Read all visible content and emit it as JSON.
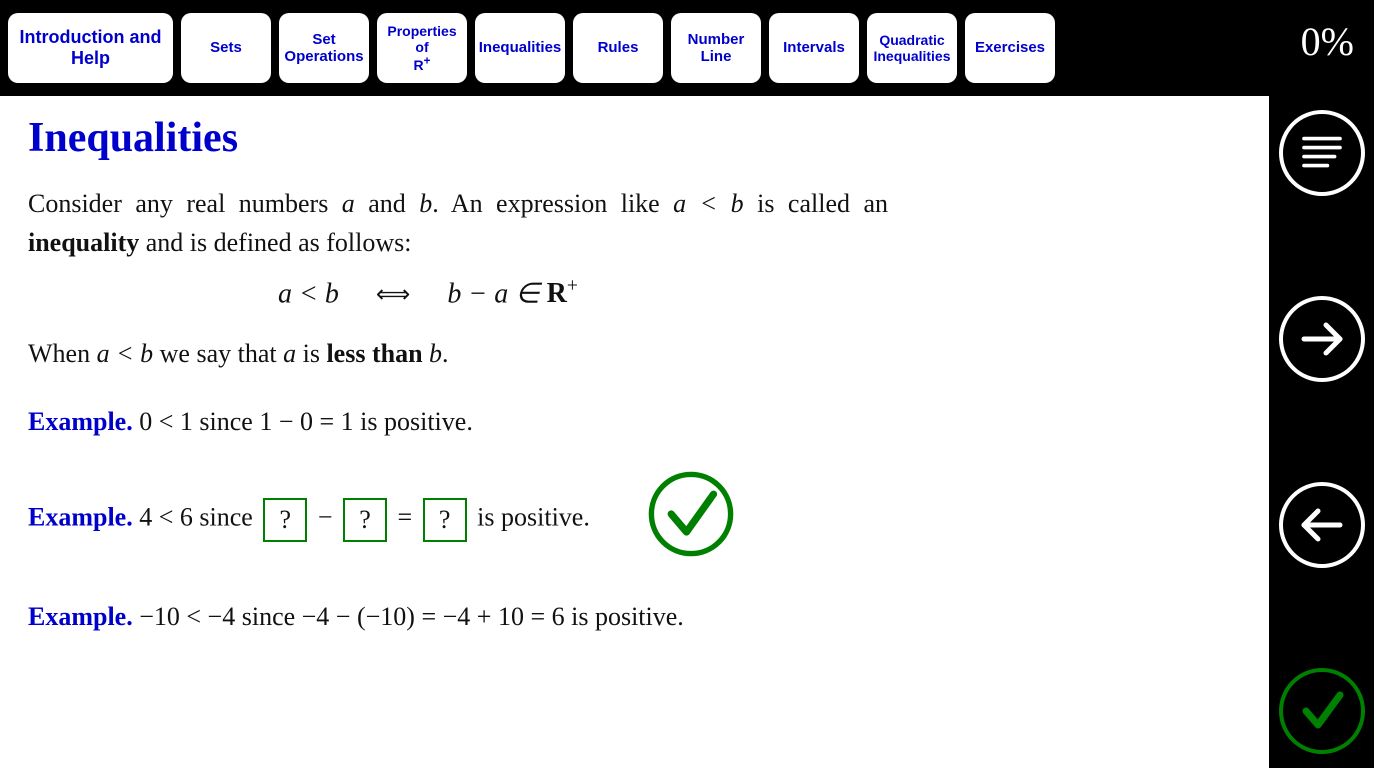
{
  "tabs": [
    {
      "label": "Introduction and Help",
      "active": true
    },
    {
      "label": "Sets"
    },
    {
      "label": "Set Operations"
    },
    {
      "label": "Properties of R⁺"
    },
    {
      "label": "Inequalities"
    },
    {
      "label": "Rules"
    },
    {
      "label": "Number Line"
    },
    {
      "label": "Intervals"
    },
    {
      "label": "Quadratic Inequalities"
    },
    {
      "label": "Exercises"
    }
  ],
  "progress": "0%",
  "title": "Inequalities",
  "intro_1a": "Consider any real numbers ",
  "intro_a": "a",
  "intro_1b": " and ",
  "intro_b": "b",
  "intro_1c": ". An expression like ",
  "intro_expr": "a < b",
  "intro_1d": " is called an ",
  "intro_bold": "inequality",
  "intro_1e": " and is defined as follows:",
  "formula_left": "a < b",
  "formula_iff": "⟺",
  "formula_right_a": "b − a ∈ ",
  "formula_R": "R",
  "formula_plus": "+",
  "when_1": "When ",
  "when_expr": "a < b",
  "when_2": " we say that ",
  "when_a": "a",
  "when_3": " is ",
  "when_bold": "less than",
  "when_b": " b",
  "when_end": ".",
  "example_label": "Example.",
  "ex1": " 0 < 1  since  1 − 0 = 1 is positive.",
  "ex2_a": " 4 < 6  since  ",
  "q": "?",
  "minus": " − ",
  "equals": " = ",
  "ex2_b": "  is positive.",
  "ex3": " −10 < −4  since  −4 − (−10) = −4 + 10 = 6 is positive.",
  "side": {
    "menu": "menu",
    "next": "next",
    "prev": "prev",
    "check": "check"
  }
}
